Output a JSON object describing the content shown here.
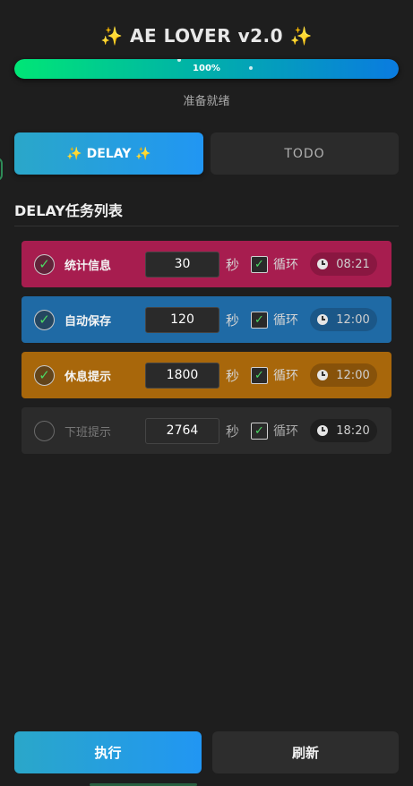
{
  "header": {
    "title": "✨ AE LOVER v2.0 ✨"
  },
  "progress": {
    "value": 1.0,
    "label": "100%"
  },
  "status_text": "准备就绪",
  "tabs": [
    {
      "label": "✨ DELAY ✨",
      "active": true
    },
    {
      "label": "TODO",
      "active": false
    }
  ],
  "section_title": "DELAY任务列表",
  "tasks": [
    {
      "enabled": true,
      "check_glyph": "✓",
      "name": "统计信息",
      "seconds": "30",
      "unit": "秒",
      "loop_glyph": "✓",
      "loop_label": "循环",
      "time": "08:21",
      "color": "#a71d4f",
      "badge_color": "#8a1741"
    },
    {
      "enabled": true,
      "check_glyph": "✓",
      "name": "自动保存",
      "seconds": "120",
      "unit": "秒",
      "loop_glyph": "✓",
      "loop_label": "循环",
      "time": "12:00",
      "color": "#1f6aa5",
      "badge_color": "#1b5788"
    },
    {
      "enabled": true,
      "check_glyph": "✓",
      "name": "休息提示",
      "seconds": "1800",
      "unit": "秒",
      "loop_glyph": "✓",
      "loop_label": "循环",
      "time": "12:00",
      "color": "#a8670b",
      "badge_color": "#87520a"
    },
    {
      "enabled": false,
      "check_glyph": "",
      "name": "下班提示",
      "seconds": "2764",
      "unit": "秒",
      "loop_glyph": "✓",
      "loop_label": "循环",
      "time": "18:20",
      "color": "#2b2b2b",
      "badge_color": "#1f1f1f"
    }
  ],
  "buttons": {
    "execute": "执行",
    "refresh": "刷新"
  },
  "colors": {
    "accent_start": "#2aa7c9",
    "accent_end": "#2196f3",
    "progress_start": "#00e676",
    "progress_end": "#0a7be0"
  }
}
